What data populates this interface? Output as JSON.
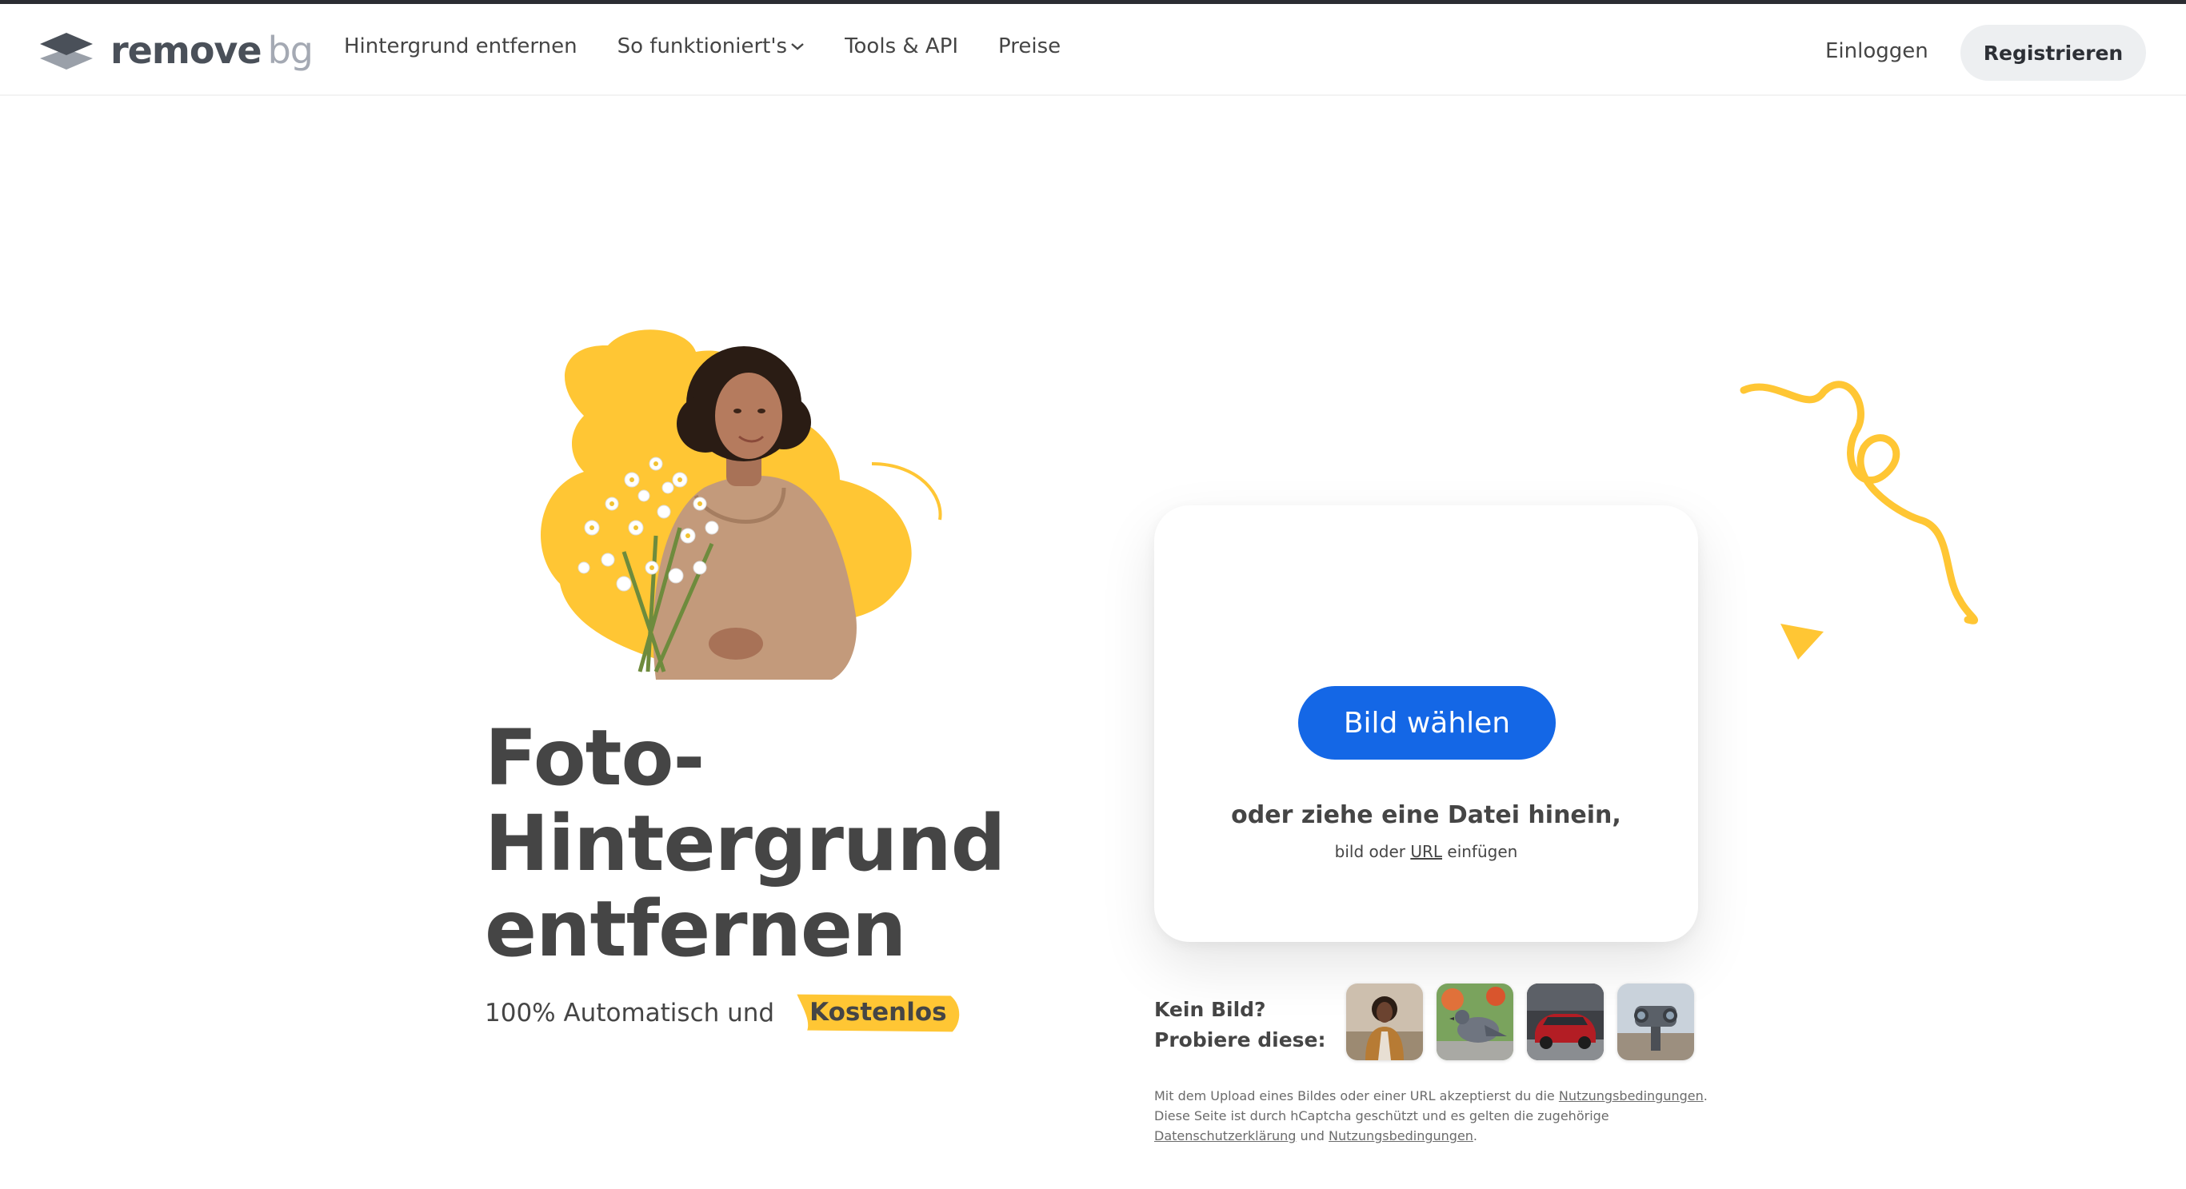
{
  "header": {
    "logo_remove": "remove",
    "logo_bg": "bg",
    "nav": {
      "remove_bg": "Hintergrund entfernen",
      "how_it_works": "So funktioniert's",
      "tools_api": "Tools & API",
      "pricing": "Preise"
    },
    "login": "Einloggen",
    "register": "Registrieren"
  },
  "hero": {
    "title_line1": "Foto-",
    "title_line2": "Hintergrund",
    "title_line3": "entfernen",
    "subtitle": "100% Automatisch und",
    "highlight": "Kostenlos"
  },
  "upload": {
    "button": "Bild wählen",
    "drop_text": "oder ziehe eine Datei hinein,",
    "paste_prefix": "bild oder",
    "paste_url": "URL",
    "paste_suffix": "einfügen"
  },
  "samples": {
    "line1": "Kein Bild?",
    "line2": "Probiere diese:",
    "items": [
      "woman-sample",
      "pigeon-sample",
      "car-sample",
      "binoculars-sample"
    ]
  },
  "legal": {
    "part1": "Mit dem Upload eines Bildes oder einer URL akzeptierst du die",
    "terms": "Nutzungsbedingungen",
    "part2": "Diese Seite ist durch hCaptcha geschützt und es gelten die zugehörige",
    "privacy": "Datenschutzerklärung",
    "and": "und",
    "terms2": "Nutzungsbedingungen"
  },
  "colors": {
    "accent_blue": "#1467e6",
    "accent_yellow": "#ffc634",
    "text": "#454545"
  }
}
